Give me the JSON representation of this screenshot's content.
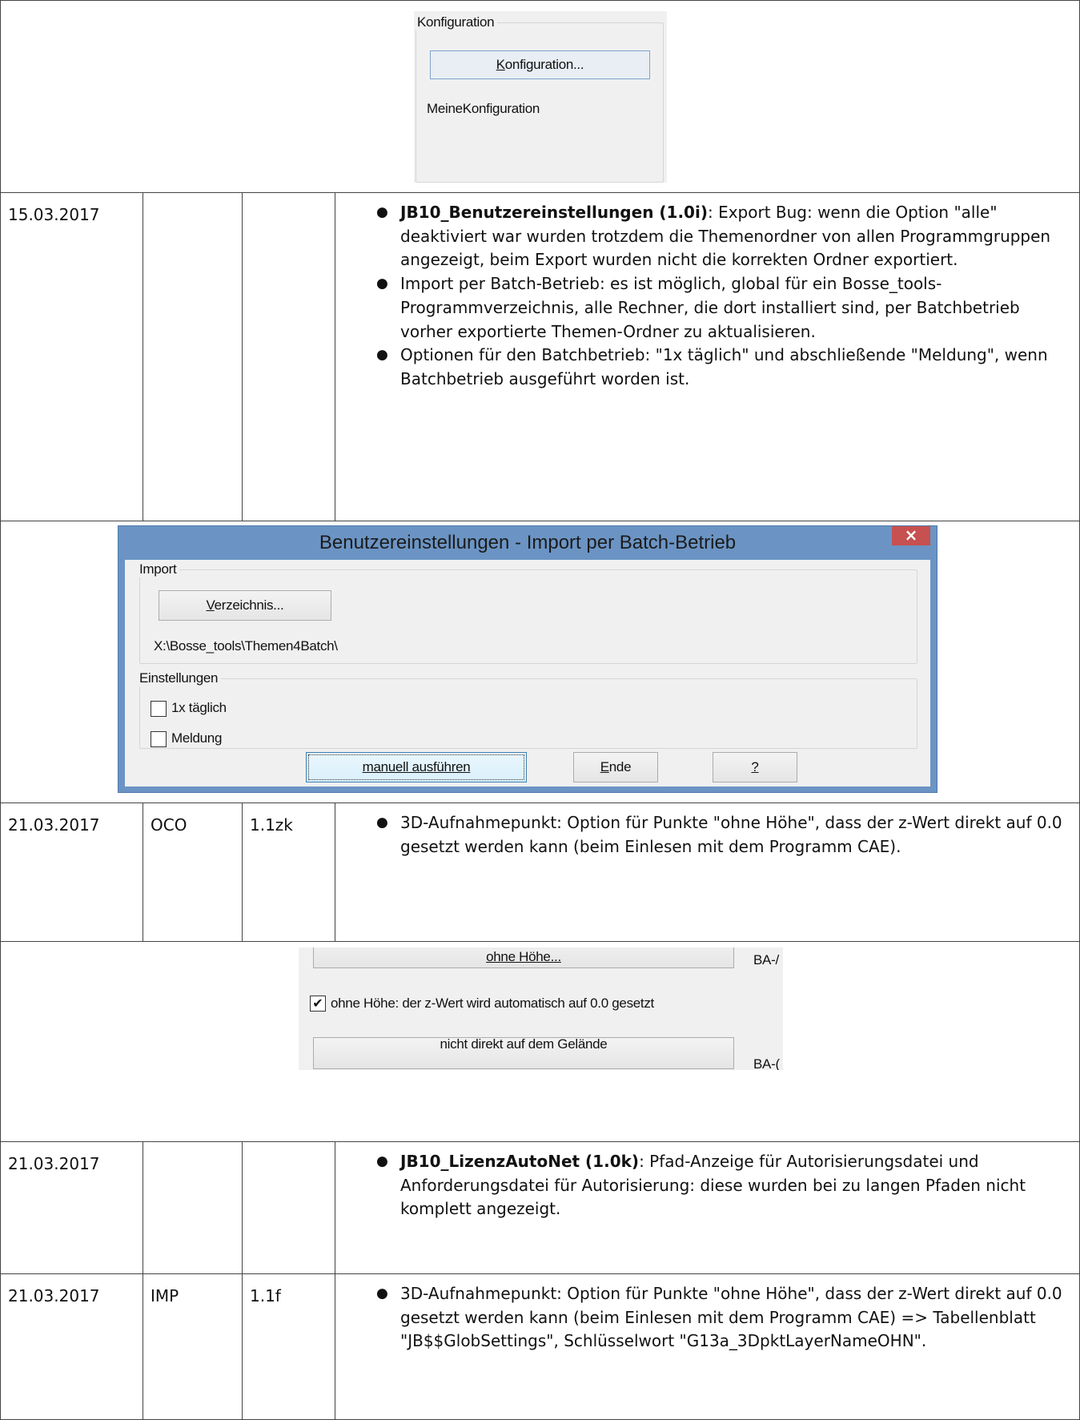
{
  "config_snippet": {
    "group_title": "Konfiguration",
    "button_label": "Konfiguration...",
    "button_mnemonic": "K",
    "button_rest": "onfiguration...",
    "value": "MeineKonfiguration"
  },
  "rows": [
    {
      "date": "15.03.2017",
      "code": "",
      "version": "",
      "items": [
        {
          "bold": "JB10_Benutzereinstellungen (1.0i)",
          "text": ": Export Bug: wenn die Option \"alle\" deaktiviert war wurden trotzdem die Themenordner von allen Programmgruppen angezeigt, beim Export wurden nicht die korrekten Ordner exportiert."
        },
        {
          "bold": "",
          "text": "Import per Batch-Betrieb: es ist möglich, global für ein Bosse_tools-Programmverzeichnis, alle Rechner, die dort installiert sind, per Batchbetrieb vorher exportierte Themen-Ordner zu aktualisieren."
        },
        {
          "bold": "",
          "text": "Optionen für den Batchbetrieb: \"1x täglich\" und abschließende \"Meldung\", wenn Batchbetrieb ausgeführt worden ist."
        }
      ]
    },
    {
      "date": "21.03.2017",
      "code": "OCO",
      "version": "1.1zk",
      "items": [
        {
          "bold": "",
          "text": "3D-Aufnahmepunkt: Option für Punkte \"ohne Höhe\", dass der z-Wert direkt auf 0.0 gesetzt werden kann (beim Einlesen mit dem Programm CAE)."
        }
      ]
    },
    {
      "date": "21.03.2017",
      "code": "",
      "version": "",
      "items": [
        {
          "bold": "JB10_LizenzAutoNet (1.0k)",
          "text": ": Pfad-Anzeige für Autorisierungsdatei und Anforderungsdatei für Autorisierung: diese wurden bei zu langen Pfaden nicht komplett angezeigt."
        }
      ]
    },
    {
      "date": "21.03.2017",
      "code": "IMP",
      "version": "1.1f",
      "items": [
        {
          "bold": "",
          "text": "3D-Aufnahmepunkt: Option für Punkte \"ohne Höhe\", dass der z-Wert direkt auf 0.0 gesetzt werden kann (beim Einlesen mit dem Programm CAE) => Tabellenblatt \"JB$$GlobSettings\", Schlüsselwort \"G13a_3DpktLayerNameOHN\"."
        }
      ]
    }
  ],
  "batch_dialog": {
    "title": "Benutzereinstellungen - Import per Batch-Betrieb",
    "close_glyph": "×",
    "import_group": "Import",
    "dir_button_mnemonic": "V",
    "dir_button_rest": "erzeichnis...",
    "dir_button_label": "Verzeichnis...",
    "path": "X:\\Bosse_tools\\Themen4Batch\\",
    "settings_group": "Einstellungen",
    "checkbox_daily": "1x täglich",
    "checkbox_message": "Meldung",
    "run_button": "manuell ausführen",
    "end_button_mnemonic": "E",
    "end_button_rest": "nde",
    "end_button": "Ende",
    "help_button": "?"
  },
  "height_snippet": {
    "top_button": "ohne Höhe...",
    "top_right": "BA-/",
    "checkbox_label": "ohne Höhe: der z-Wert wird automatisch auf 0.0 gesetzt",
    "check_glyph": "✔",
    "bottom_button": "nicht direkt auf dem Gelände",
    "bottom_right": "BA-("
  }
}
